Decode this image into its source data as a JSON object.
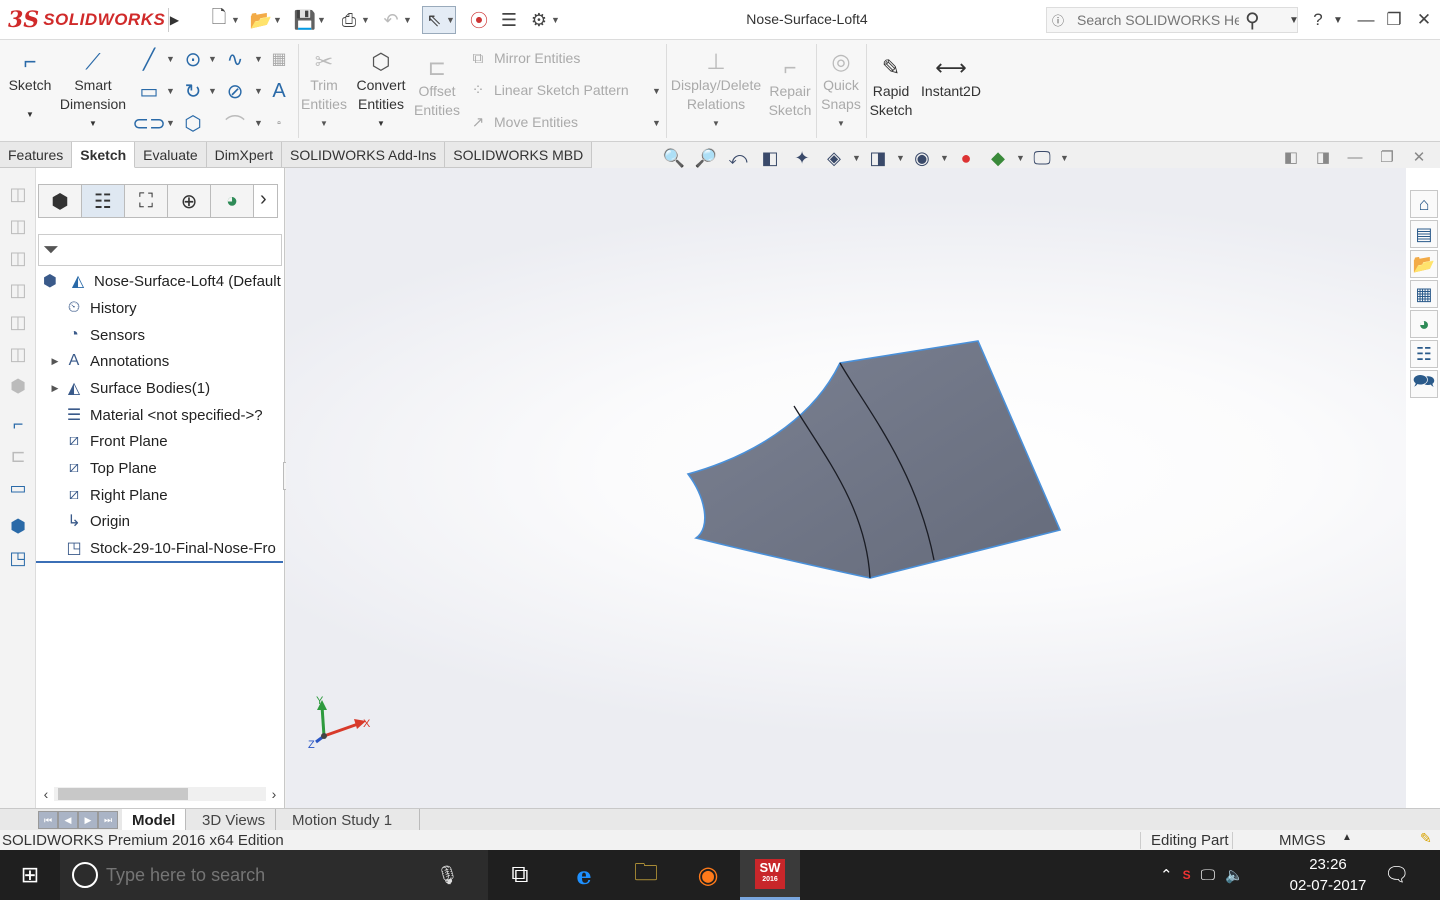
{
  "app": {
    "brand_ds": "3S",
    "brand_word": "SOLIDWORKS",
    "doc_title": "Nose-Surface-Loft4",
    "help_placeholder": "Search SOLIDWORKS Help"
  },
  "toolbar": {
    "sketch": "Sketch",
    "smart_dimension_1": "Smart",
    "smart_dimension_2": "Dimension",
    "trim_1": "Trim",
    "trim_2": "Entities",
    "convert_1": "Convert",
    "convert_2": "Entities",
    "offset_1": "Offset",
    "offset_2": "Entities",
    "mirror": "Mirror Entities",
    "linear_pattern": "Linear Sketch Pattern",
    "move": "Move Entities",
    "display_delete_1": "Display/Delete",
    "display_delete_2": "Relations",
    "repair_1": "Repair",
    "repair_2": "Sketch",
    "quick_snaps_1": "Quick",
    "quick_snaps_2": "Snaps",
    "rapid_1": "Rapid",
    "rapid_2": "Sketch",
    "instant2d": "Instant2D"
  },
  "tabs": [
    "Features",
    "Sketch",
    "Evaluate",
    "DimXpert",
    "SOLIDWORKS Add-Ins",
    "SOLIDWORKS MBD"
  ],
  "active_tab": "Sketch",
  "tree": {
    "root": "Nose-Surface-Loft4  (Default",
    "items": [
      {
        "label": "History",
        "icon": "history-icon",
        "expandable": false
      },
      {
        "label": "Sensors",
        "icon": "sensors-icon",
        "expandable": false
      },
      {
        "label": "Annotations",
        "icon": "annotations-icon",
        "expandable": true
      },
      {
        "label": "Surface Bodies(1)",
        "icon": "surface-bodies-icon",
        "expandable": true
      },
      {
        "label": "Material <not specified->?",
        "icon": "material-icon",
        "expandable": false
      },
      {
        "label": "Front Plane",
        "icon": "plane-icon",
        "expandable": false
      },
      {
        "label": "Top Plane",
        "icon": "plane-icon",
        "expandable": false
      },
      {
        "label": "Right Plane",
        "icon": "plane-icon",
        "expandable": false
      },
      {
        "label": "Origin",
        "icon": "origin-icon",
        "expandable": false
      },
      {
        "label": "Stock-29-10-Final-Nose-Fro",
        "icon": "stock-part-icon",
        "expandable": false
      }
    ]
  },
  "triad": {
    "x": "X",
    "y": "Y",
    "z": "Z"
  },
  "bottom_tabs": [
    "Model",
    "3D Views",
    "Motion Study 1"
  ],
  "active_bottom_tab": "Model",
  "status": {
    "edition": "SOLIDWORKS Premium 2016 x64 Edition",
    "mode": "Editing Part",
    "units": "MMGS"
  },
  "taskbar": {
    "search_placeholder": "Type here to search",
    "sw_badge": "SW",
    "sw_year": "2016",
    "time": "23:26",
    "date": "02-07-2017"
  },
  "colors": {
    "surface": "#6e7484",
    "edge": "#4a90d9",
    "brand": "#d02a2a",
    "accent": "#3b6fb6"
  }
}
